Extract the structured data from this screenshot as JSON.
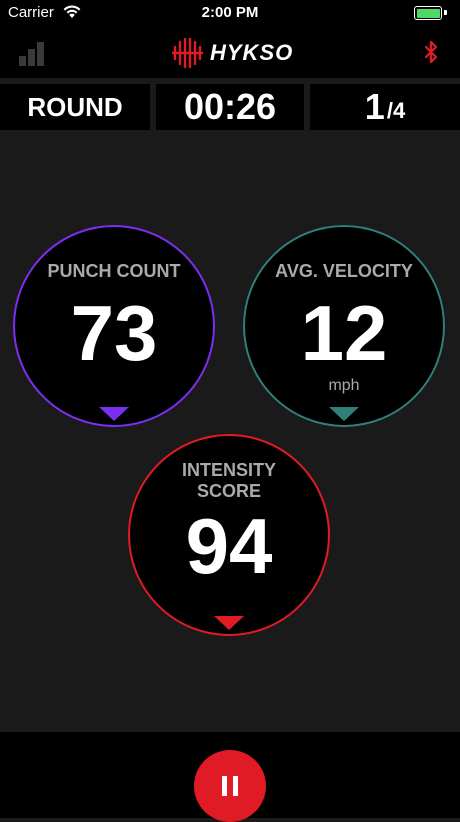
{
  "status_bar": {
    "carrier": "Carrier",
    "time": "2:00 PM"
  },
  "header": {
    "brand": "HYKSO"
  },
  "round": {
    "label": "ROUND",
    "timer": "00:26",
    "current": "1",
    "total": "/4"
  },
  "metrics": {
    "punch_count": {
      "label": "PUNCH COUNT",
      "value": "73",
      "color": "#7b2ff2"
    },
    "avg_velocity": {
      "label": "AVG. VELOCITY",
      "value": "12",
      "unit": "mph",
      "color": "#2f7f7a"
    },
    "intensity_score": {
      "label_line1": "INTENSITY",
      "label_line2": "SCORE",
      "value": "94",
      "color": "#e11b25"
    }
  },
  "colors": {
    "accent": "#e11b25",
    "background": "#1a1a1a",
    "bar_background": "#000000"
  },
  "icons": {
    "stats": "bar-chart-icon",
    "bluetooth": "bluetooth-icon",
    "pause": "pause-icon",
    "wifi": "wifi-icon",
    "battery": "battery-icon"
  }
}
